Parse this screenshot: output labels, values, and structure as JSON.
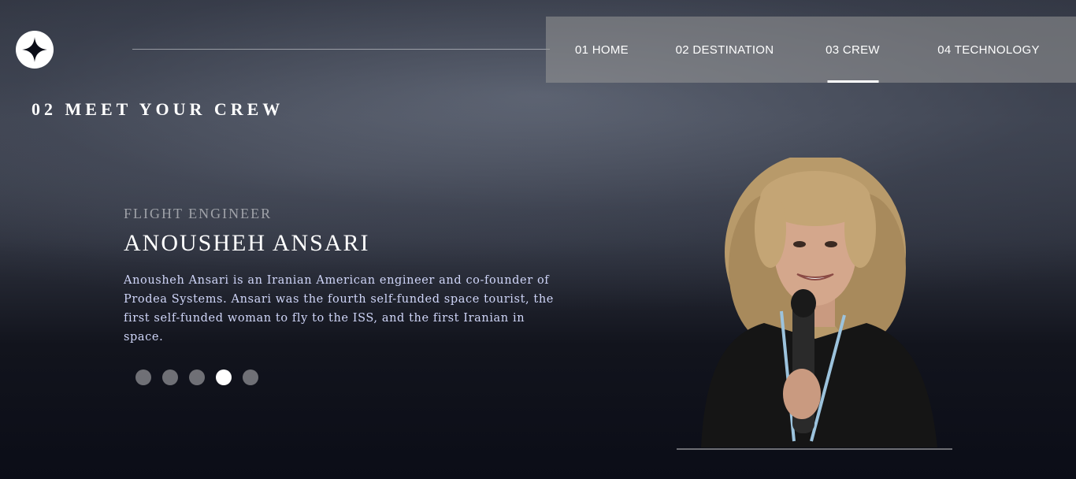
{
  "nav": {
    "items": [
      {
        "label": "01 HOME"
      },
      {
        "label": "02 DESTINATION"
      },
      {
        "label": "03 CREW"
      },
      {
        "label": "04 TECHNOLOGY"
      }
    ],
    "active_index": 2
  },
  "page": {
    "heading": "02 MEET YOUR CREW"
  },
  "crew": {
    "role": "FLIGHT ENGINEER",
    "name": "ANOUSHEH ANSARI",
    "bio": "Anousheh Ansari is an Iranian American engineer and co-founder of Prodea Systems. Ansari was the fourth self-funded space tourist, the first self-funded woman to fly to the ISS, and the first Iranian in space."
  },
  "carousel": {
    "count": 5,
    "active_index": 3
  },
  "icons": {
    "logo": "star-icon"
  },
  "colors": {
    "background": "#0b0d17",
    "accent": "#ffffff",
    "body_text": "#d0d6f9"
  }
}
